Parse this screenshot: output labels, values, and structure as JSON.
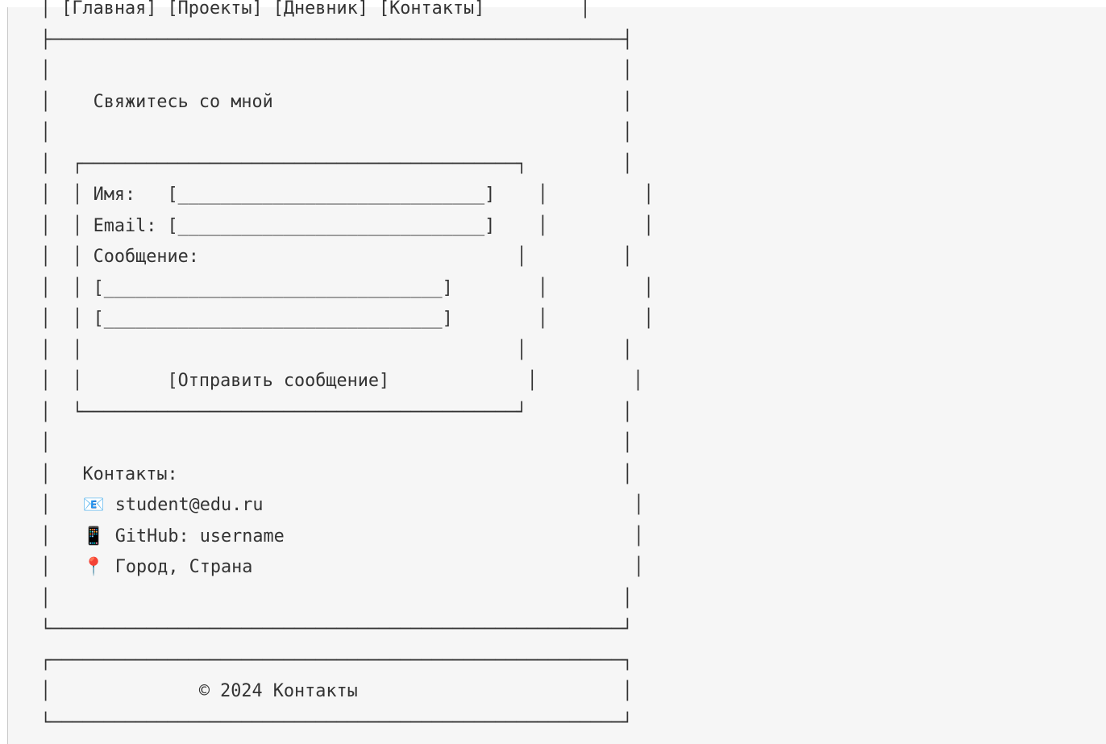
{
  "nav": {
    "items": [
      {
        "label": "Главная"
      },
      {
        "label": "Проекты"
      },
      {
        "label": "Дневник"
      },
      {
        "label": "Контакты"
      }
    ]
  },
  "contact_section": {
    "title": "Свяжитесь со мной"
  },
  "form": {
    "name_label": "Имя:",
    "email_label": "Email:",
    "message_label": "Сообщение:",
    "short_field_blank": "[_____________________________]",
    "long_field_blank": "[________________________________]",
    "submit_label": "[Отправить сообщение]"
  },
  "contacts": {
    "heading": "Контакты:",
    "items": [
      {
        "icon": "envelope-icon",
        "glyph": "📧",
        "text": "student@edu.ru"
      },
      {
        "icon": "phone-icon",
        "glyph": "📱",
        "text": "GitHub: username"
      },
      {
        "icon": "location-pin-icon",
        "glyph": "📍",
        "text": "Город, Страна"
      }
    ]
  },
  "footer": {
    "copyright": "© 2024 Контакты"
  }
}
